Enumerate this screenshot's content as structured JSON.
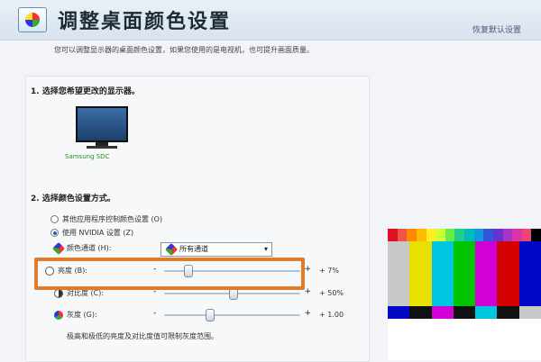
{
  "header": {
    "title": "调整桌面颜色设置",
    "restore_label": "恢复默认设置",
    "icon": "display-color-icon"
  },
  "description": "您可以调整显示器的桌面颜色设置，如果您使用的是电视机，也可提升画面质量。",
  "section1": {
    "heading": "1.  选择您希望更改的显示器。",
    "monitor_label": "Samsung SDC",
    "icon": "monitor-icon"
  },
  "section2": {
    "heading": "2.  选择颜色设置方式。",
    "options": [
      {
        "label": "其他应用程序控制颜色设置 (O)",
        "selected": false
      },
      {
        "label": "使用 NVIDIA 设置 (Z)",
        "selected": true
      }
    ],
    "channel": {
      "label": "颜色通道 (H):",
      "value": "所有通道",
      "icon": "color-channel-icon"
    },
    "sliders": [
      {
        "label": "亮度 (B):",
        "value_text": "+ 7%",
        "level": 0.17,
        "icon": "brightness-icon"
      },
      {
        "label": "对比度 (C):",
        "value_text": "+ 50%",
        "level": 0.5,
        "icon": "contrast-icon"
      },
      {
        "label": "灰度 (G):",
        "value_text": "+ 1.00",
        "level": 0.33,
        "icon": "gamma-icon"
      }
    ],
    "hint": "极高和极低的亮度及对比度值可限制灰度范围。"
  },
  "slider_symbols": {
    "minus": "-",
    "plus": "+"
  },
  "colors": {
    "accent_highlight": "#e07b2a",
    "monitor_label": "#2a8a2a",
    "test_strip": [
      "#d12",
      "#e54",
      "#f80",
      "#fb0",
      "#fe2",
      "#cf3",
      "#6e4",
      "#2c8",
      "#0bb",
      "#19d",
      "#35d",
      "#63c",
      "#a3c",
      "#d3a",
      "#e47",
      "#000"
    ],
    "test_bars": [
      "#c8c8c8",
      "#e7e000",
      "#00c7e1",
      "#00c400",
      "#d100d6",
      "#d50000",
      "#0008c6"
    ],
    "test_blocks": [
      "#0008c6",
      "#111",
      "#d100d6",
      "#111",
      "#00c7e1",
      "#111",
      "#c8c8c8"
    ],
    "test_bottom": [
      "#0d2d4d",
      "#f5f5f5",
      "#26004a",
      "#222",
      "#0b0b0b"
    ]
  }
}
